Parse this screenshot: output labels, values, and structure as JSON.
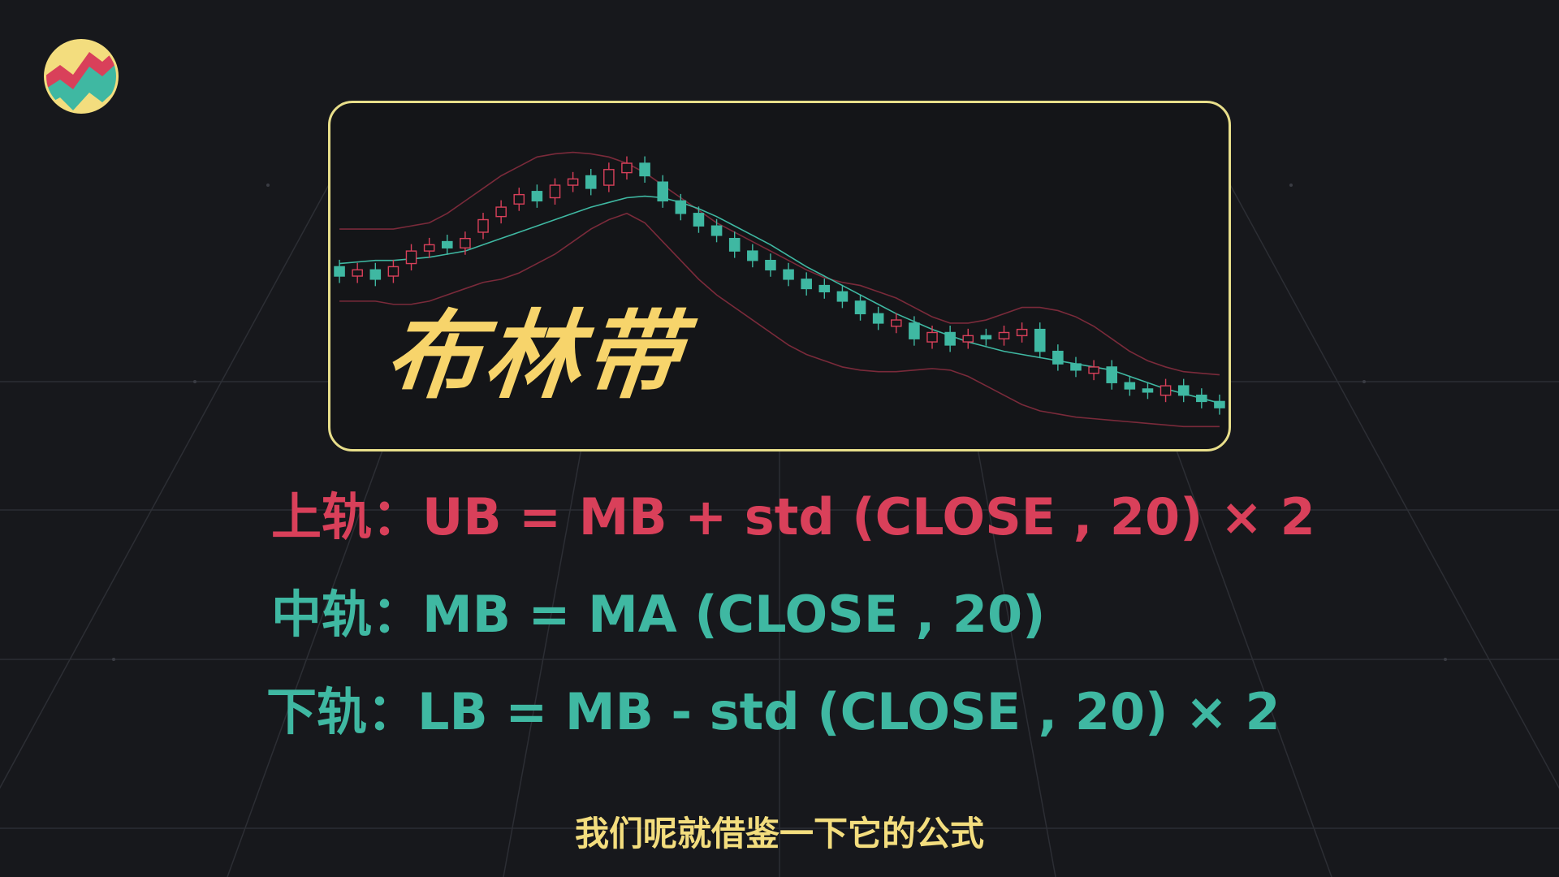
{
  "chart_title": "布林带",
  "formulas": {
    "upper": "上轨：UB = MB + std (CLOSE , 20) × 2",
    "middle": "中轨：MB = MA (CLOSE , 20)",
    "lower": "下轨：LB = MB - std (CLOSE , 20) × 2"
  },
  "subtitle": "我们呢就借鉴一下它的公式",
  "colors": {
    "background": "#17181c",
    "card_border": "#e8de8a",
    "title": "#f7d46b",
    "upper_text": "#d9405a",
    "band_text": "#3fb8a2",
    "subtitle": "#f3dd7e",
    "candle_up": "#d9405a",
    "candle_down": "#3fb8a2"
  },
  "icons": {
    "logo": "chart-logo-icon"
  },
  "chart_data": {
    "type": "candlestick",
    "title": "",
    "xlabel": "",
    "ylabel": "",
    "grid": false,
    "legend": "none",
    "ylim": [
      0,
      100
    ],
    "middle": [
      54,
      54.5,
      55,
      55,
      55.5,
      56,
      57,
      58,
      60,
      62,
      64,
      66,
      68,
      70,
      72,
      73.5,
      75,
      75.5,
      75,
      73.5,
      71.5,
      69,
      66,
      63,
      60,
      56.5,
      53,
      50,
      47,
      44,
      41,
      38,
      35.5,
      33,
      31,
      29,
      27.5,
      26,
      25,
      24,
      23,
      22,
      21,
      20,
      18,
      16,
      14,
      12.5,
      11,
      9.5
    ],
    "upper": [
      65,
      65,
      65,
      65,
      66,
      67,
      70,
      74,
      78,
      82,
      85,
      88,
      89,
      89.5,
      89,
      88,
      86,
      83,
      79,
      75,
      71,
      67,
      64,
      61,
      58,
      55,
      52,
      49.5,
      48,
      47,
      45,
      43,
      40,
      37,
      35,
      35,
      36,
      38,
      40,
      40,
      39,
      37,
      34,
      30,
      26,
      23,
      21,
      19.5,
      19,
      18.5
    ],
    "lower": [
      42,
      42,
      42,
      41,
      41,
      42,
      44,
      46,
      48,
      49,
      51,
      54,
      57,
      61,
      65,
      68,
      70,
      67,
      61,
      55,
      49,
      44,
      40,
      36,
      32,
      28,
      25,
      23,
      21,
      20,
      19.5,
      19.5,
      20,
      20.5,
      20,
      18,
      15,
      12,
      9,
      7,
      6,
      5,
      4.5,
      4,
      3.5,
      3,
      2.5,
      2,
      2,
      2
    ],
    "close": [
      50,
      52,
      49,
      53,
      58,
      60,
      59,
      62,
      68,
      72,
      76,
      74,
      79,
      81,
      78,
      84,
      86,
      82,
      74,
      70,
      66,
      63,
      58,
      55,
      52,
      49,
      46,
      45,
      42,
      38,
      35,
      36,
      30,
      32,
      28,
      31,
      30,
      32,
      33,
      26,
      22,
      20,
      21,
      16,
      14,
      13,
      15,
      12,
      10,
      8
    ],
    "open": [
      53,
      50,
      52,
      50,
      54,
      58,
      61,
      59,
      64,
      69,
      73,
      77,
      75,
      79,
      82,
      79,
      83,
      86,
      80,
      74,
      70,
      66,
      62,
      58,
      55,
      52,
      49,
      47,
      45,
      42,
      38,
      34,
      35,
      29,
      32,
      29,
      31,
      30,
      31,
      33,
      26,
      22,
      19,
      21,
      16,
      14,
      12,
      15,
      12,
      10
    ]
  }
}
